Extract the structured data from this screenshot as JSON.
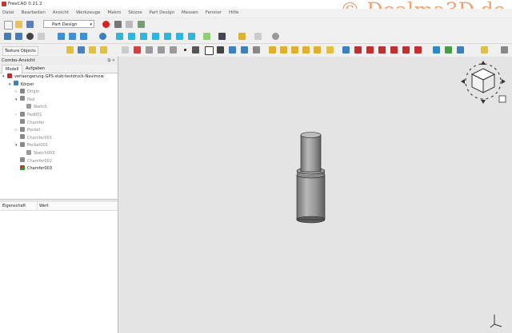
{
  "window": {
    "title": "FreeCAD 0.21.2",
    "watermark": "© Dealma3D.de"
  },
  "menu": [
    "Datei",
    "Bearbeiten",
    "Ansicht",
    "Werkzeuge",
    "Makro",
    "Skizze",
    "Part Design",
    "Messen",
    "Fenster",
    "Hilfe"
  ],
  "toolbar": {
    "workbench": "Part Design",
    "texture_button": "Texture Objects"
  },
  "combo": {
    "title": "Combo-Ansicht",
    "tabs": [
      "Modell",
      "Aufgaben"
    ],
    "tree": [
      {
        "label": "verlaengerung-GPS-stab-testdruck-Navimow",
        "depth": 0,
        "twisty": "▾",
        "icon": "doc"
      },
      {
        "label": "Körper",
        "depth": 1,
        "twisty": "▾",
        "icon": "body"
      },
      {
        "label": "Origin",
        "depth": 2,
        "twisty": "›",
        "icon": "origin",
        "muted": true
      },
      {
        "label": "Pad",
        "depth": 2,
        "twisty": "▾",
        "icon": "feature",
        "muted": true
      },
      {
        "label": "Sketch",
        "depth": 3,
        "twisty": "",
        "icon": "sketch",
        "muted": true
      },
      {
        "label": "Pad001",
        "depth": 2,
        "twisty": "›",
        "icon": "feature",
        "muted": true
      },
      {
        "label": "Chamfer",
        "depth": 2,
        "twisty": "",
        "icon": "feature",
        "muted": true
      },
      {
        "label": "Pocket",
        "depth": 2,
        "twisty": "›",
        "icon": "feature",
        "muted": true
      },
      {
        "label": "Chamfer001",
        "depth": 2,
        "twisty": "",
        "icon": "feature",
        "muted": true
      },
      {
        "label": "Pocket001",
        "depth": 2,
        "twisty": "▾",
        "icon": "feature",
        "muted": true
      },
      {
        "label": "Sketch003",
        "depth": 3,
        "twisty": "",
        "icon": "sketch",
        "muted": true
      },
      {
        "label": "Chamfer002",
        "depth": 2,
        "twisty": "",
        "icon": "feature",
        "muted": true
      },
      {
        "label": "Chamfer003",
        "depth": 2,
        "twisty": "",
        "icon": "tip",
        "muted": false
      }
    ]
  },
  "properties": {
    "col_property": "Eigenschaft",
    "col_value": "Wert"
  },
  "navcube": {
    "faces": [
      "",
      "",
      ""
    ]
  },
  "colors": {
    "accent_red": "#d62020",
    "cube_cyan": "#2ab8e0",
    "viewport_bg": "#e4e4e4"
  }
}
